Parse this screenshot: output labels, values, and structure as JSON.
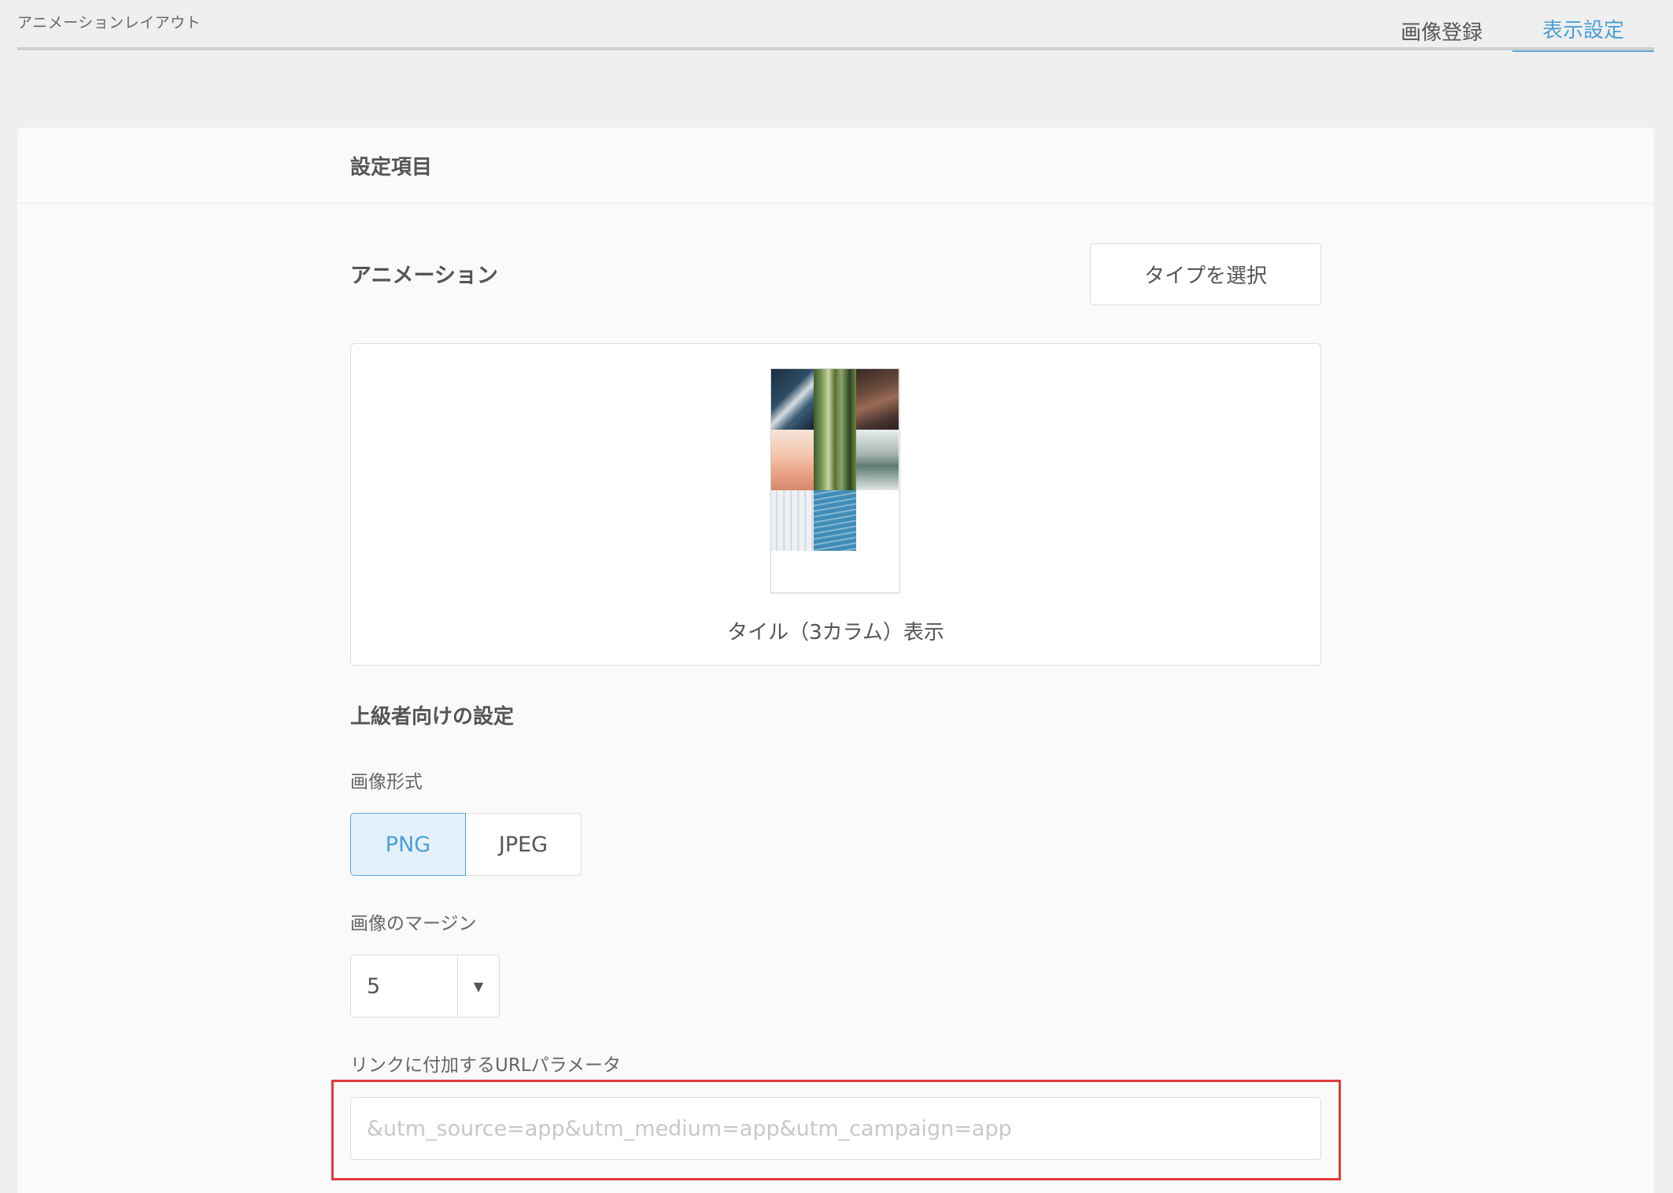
{
  "header": {
    "app_title": "アニメーションレイアウト",
    "tabs": [
      {
        "label": "画像登録",
        "active": false
      },
      {
        "label": "表示設定",
        "active": true
      }
    ]
  },
  "card": {
    "title": "設定項目"
  },
  "animation": {
    "section_title": "アニメーション",
    "select_type_button": "タイプを選択",
    "preview_caption": "タイル（3カラム）表示"
  },
  "advanced": {
    "section_title": "上級者向けの設定",
    "image_format": {
      "label": "画像形式",
      "options": [
        "PNG",
        "JPEG"
      ],
      "selected": "PNG"
    },
    "image_margin": {
      "label": "画像のマージン",
      "value": "5"
    },
    "url_params": {
      "label": "リンクに付加するURLパラメータ",
      "value": "",
      "placeholder": "&utm_source=app&utm_medium=app&utm_campaign=app"
    }
  },
  "colors": {
    "accent": "#5aaae0",
    "accent_text": "#4a9fd8",
    "selected_bg": "#e4f1fb",
    "highlight": "#e03a3a",
    "page_bg": "#efefef",
    "card_bg": "#fafafa"
  },
  "icons": {
    "select_arrow": "triangle-down-icon"
  }
}
